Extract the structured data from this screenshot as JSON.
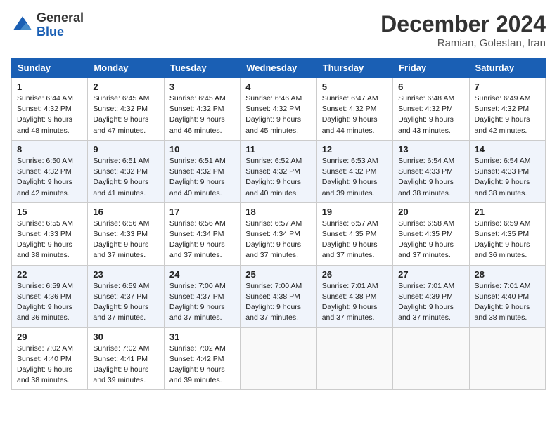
{
  "header": {
    "logo_line1": "General",
    "logo_line2": "Blue",
    "month_title": "December 2024",
    "location": "Ramian, Golestan, Iran"
  },
  "weekdays": [
    "Sunday",
    "Monday",
    "Tuesday",
    "Wednesday",
    "Thursday",
    "Friday",
    "Saturday"
  ],
  "weeks": [
    [
      {
        "day": "1",
        "sunrise": "6:44 AM",
        "sunset": "4:32 PM",
        "daylight": "9 hours and 48 minutes."
      },
      {
        "day": "2",
        "sunrise": "6:45 AM",
        "sunset": "4:32 PM",
        "daylight": "9 hours and 47 minutes."
      },
      {
        "day": "3",
        "sunrise": "6:45 AM",
        "sunset": "4:32 PM",
        "daylight": "9 hours and 46 minutes."
      },
      {
        "day": "4",
        "sunrise": "6:46 AM",
        "sunset": "4:32 PM",
        "daylight": "9 hours and 45 minutes."
      },
      {
        "day": "5",
        "sunrise": "6:47 AM",
        "sunset": "4:32 PM",
        "daylight": "9 hours and 44 minutes."
      },
      {
        "day": "6",
        "sunrise": "6:48 AM",
        "sunset": "4:32 PM",
        "daylight": "9 hours and 43 minutes."
      },
      {
        "day": "7",
        "sunrise": "6:49 AM",
        "sunset": "4:32 PM",
        "daylight": "9 hours and 42 minutes."
      }
    ],
    [
      {
        "day": "8",
        "sunrise": "6:50 AM",
        "sunset": "4:32 PM",
        "daylight": "9 hours and 42 minutes."
      },
      {
        "day": "9",
        "sunrise": "6:51 AM",
        "sunset": "4:32 PM",
        "daylight": "9 hours and 41 minutes."
      },
      {
        "day": "10",
        "sunrise": "6:51 AM",
        "sunset": "4:32 PM",
        "daylight": "9 hours and 40 minutes."
      },
      {
        "day": "11",
        "sunrise": "6:52 AM",
        "sunset": "4:32 PM",
        "daylight": "9 hours and 40 minutes."
      },
      {
        "day": "12",
        "sunrise": "6:53 AM",
        "sunset": "4:32 PM",
        "daylight": "9 hours and 39 minutes."
      },
      {
        "day": "13",
        "sunrise": "6:54 AM",
        "sunset": "4:33 PM",
        "daylight": "9 hours and 38 minutes."
      },
      {
        "day": "14",
        "sunrise": "6:54 AM",
        "sunset": "4:33 PM",
        "daylight": "9 hours and 38 minutes."
      }
    ],
    [
      {
        "day": "15",
        "sunrise": "6:55 AM",
        "sunset": "4:33 PM",
        "daylight": "9 hours and 38 minutes."
      },
      {
        "day": "16",
        "sunrise": "6:56 AM",
        "sunset": "4:33 PM",
        "daylight": "9 hours and 37 minutes."
      },
      {
        "day": "17",
        "sunrise": "6:56 AM",
        "sunset": "4:34 PM",
        "daylight": "9 hours and 37 minutes."
      },
      {
        "day": "18",
        "sunrise": "6:57 AM",
        "sunset": "4:34 PM",
        "daylight": "9 hours and 37 minutes."
      },
      {
        "day": "19",
        "sunrise": "6:57 AM",
        "sunset": "4:35 PM",
        "daylight": "9 hours and 37 minutes."
      },
      {
        "day": "20",
        "sunrise": "6:58 AM",
        "sunset": "4:35 PM",
        "daylight": "9 hours and 37 minutes."
      },
      {
        "day": "21",
        "sunrise": "6:59 AM",
        "sunset": "4:35 PM",
        "daylight": "9 hours and 36 minutes."
      }
    ],
    [
      {
        "day": "22",
        "sunrise": "6:59 AM",
        "sunset": "4:36 PM",
        "daylight": "9 hours and 36 minutes."
      },
      {
        "day": "23",
        "sunrise": "6:59 AM",
        "sunset": "4:37 PM",
        "daylight": "9 hours and 37 minutes."
      },
      {
        "day": "24",
        "sunrise": "7:00 AM",
        "sunset": "4:37 PM",
        "daylight": "9 hours and 37 minutes."
      },
      {
        "day": "25",
        "sunrise": "7:00 AM",
        "sunset": "4:38 PM",
        "daylight": "9 hours and 37 minutes."
      },
      {
        "day": "26",
        "sunrise": "7:01 AM",
        "sunset": "4:38 PM",
        "daylight": "9 hours and 37 minutes."
      },
      {
        "day": "27",
        "sunrise": "7:01 AM",
        "sunset": "4:39 PM",
        "daylight": "9 hours and 37 minutes."
      },
      {
        "day": "28",
        "sunrise": "7:01 AM",
        "sunset": "4:40 PM",
        "daylight": "9 hours and 38 minutes."
      }
    ],
    [
      {
        "day": "29",
        "sunrise": "7:02 AM",
        "sunset": "4:40 PM",
        "daylight": "9 hours and 38 minutes."
      },
      {
        "day": "30",
        "sunrise": "7:02 AM",
        "sunset": "4:41 PM",
        "daylight": "9 hours and 39 minutes."
      },
      {
        "day": "31",
        "sunrise": "7:02 AM",
        "sunset": "4:42 PM",
        "daylight": "9 hours and 39 minutes."
      },
      null,
      null,
      null,
      null
    ]
  ]
}
